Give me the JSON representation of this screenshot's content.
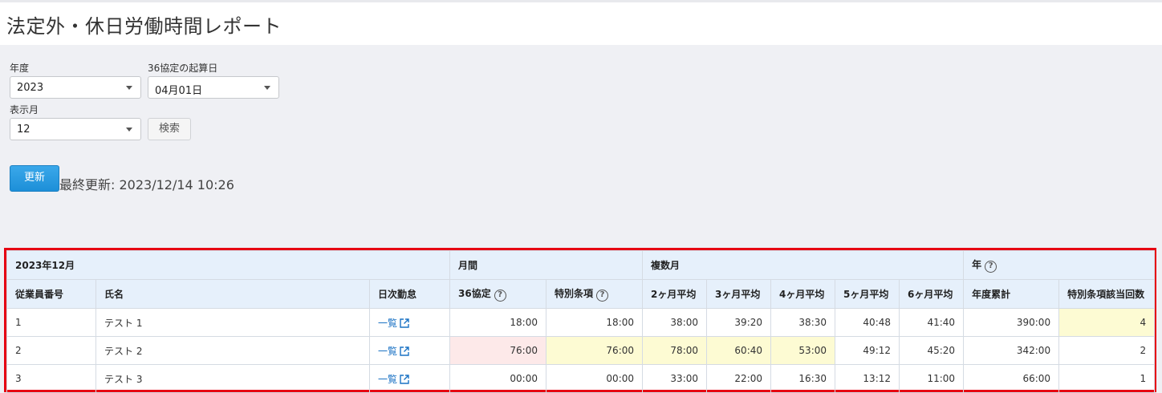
{
  "page": {
    "title": "法定外・休日労働時間レポート"
  },
  "filters": {
    "year_label": "年度",
    "year_value": "2023",
    "start_label": "36協定の起算日",
    "start_value": "04月01日",
    "month_label": "表示月",
    "month_value": "12",
    "search_label": "検索"
  },
  "update": {
    "button_label": "更新",
    "last_update": "最終更新: 2023/12/14 10:26"
  },
  "table": {
    "group_headers": {
      "period": "2023年12月",
      "monthly": "月間",
      "multi_month": "複数月",
      "year": "年"
    },
    "columns": {
      "emp_no": "従業員番号",
      "name": "氏名",
      "daily": "日次勤怠",
      "agreement36": "36協定",
      "special": "特別条項",
      "avg2": "2ヶ月平均",
      "avg3": "3ヶ月平均",
      "avg4": "4ヶ月平均",
      "avg5": "5ヶ月平均",
      "avg6": "6ヶ月平均",
      "year_total": "年度累計",
      "special_count": "特別条項該当回数"
    },
    "rows": [
      {
        "emp_no": "1",
        "name": "テスト 1",
        "link": "一覧",
        "agreement36": "18:00",
        "special": "18:00",
        "avg2": "38:00",
        "avg3": "39:20",
        "avg4": "38:30",
        "avg5": "40:48",
        "avg6": "41:40",
        "year_total": "390:00",
        "special_count": "4"
      },
      {
        "emp_no": "2",
        "name": "テスト 2",
        "link": "一覧",
        "agreement36": "76:00",
        "special": "76:00",
        "avg2": "78:00",
        "avg3": "60:40",
        "avg4": "53:00",
        "avg5": "49:12",
        "avg6": "45:20",
        "year_total": "342:00",
        "special_count": "2"
      },
      {
        "emp_no": "3",
        "name": "テスト 3",
        "link": "一覧",
        "agreement36": "00:00",
        "special": "00:00",
        "avg2": "33:00",
        "avg3": "22:00",
        "avg4": "16:30",
        "avg5": "13:12",
        "avg6": "11:00",
        "year_total": "66:00",
        "special_count": "1"
      }
    ]
  },
  "icons": {
    "help": "?",
    "external_link": "external-link-icon",
    "dropdown": "chevron-down-icon"
  },
  "colors": {
    "highlight_yellow": "#fdfbd3",
    "highlight_pink": "#fde9e9",
    "frame_red": "#e60012",
    "primary_blue": "#1d8fd8"
  }
}
